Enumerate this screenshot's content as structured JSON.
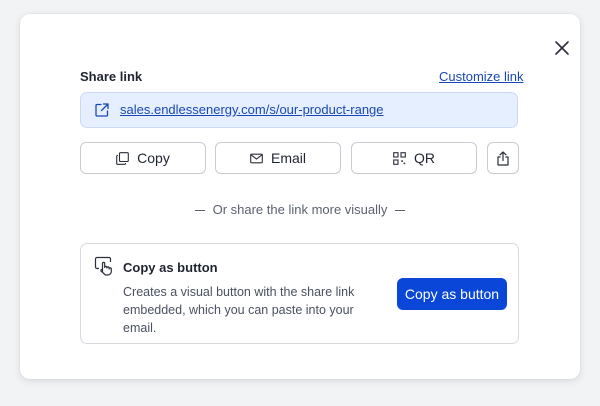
{
  "dialog": {
    "share_label": "Share link",
    "customize_label": "Customize link",
    "url": "sales.endlessenergy.com/s/our-product-range",
    "buttons": {
      "copy": "Copy",
      "email": "Email",
      "qr": "QR"
    },
    "divider_text": "Or share the link more visually",
    "copy_as_button_card": {
      "title": "Copy as button",
      "description": "Creates a visual button with the share link embedded, which you can paste into your email.",
      "cta_label": "Copy as button"
    }
  },
  "icons": [
    "close-icon",
    "external-link-icon",
    "copy-icon",
    "email-icon",
    "qr-icon",
    "share-icon",
    "hand-pointer-icon"
  ],
  "colors": {
    "accent": "#0a46d8",
    "link": "#1a47b8",
    "link_box_bg": "#e6efff"
  }
}
